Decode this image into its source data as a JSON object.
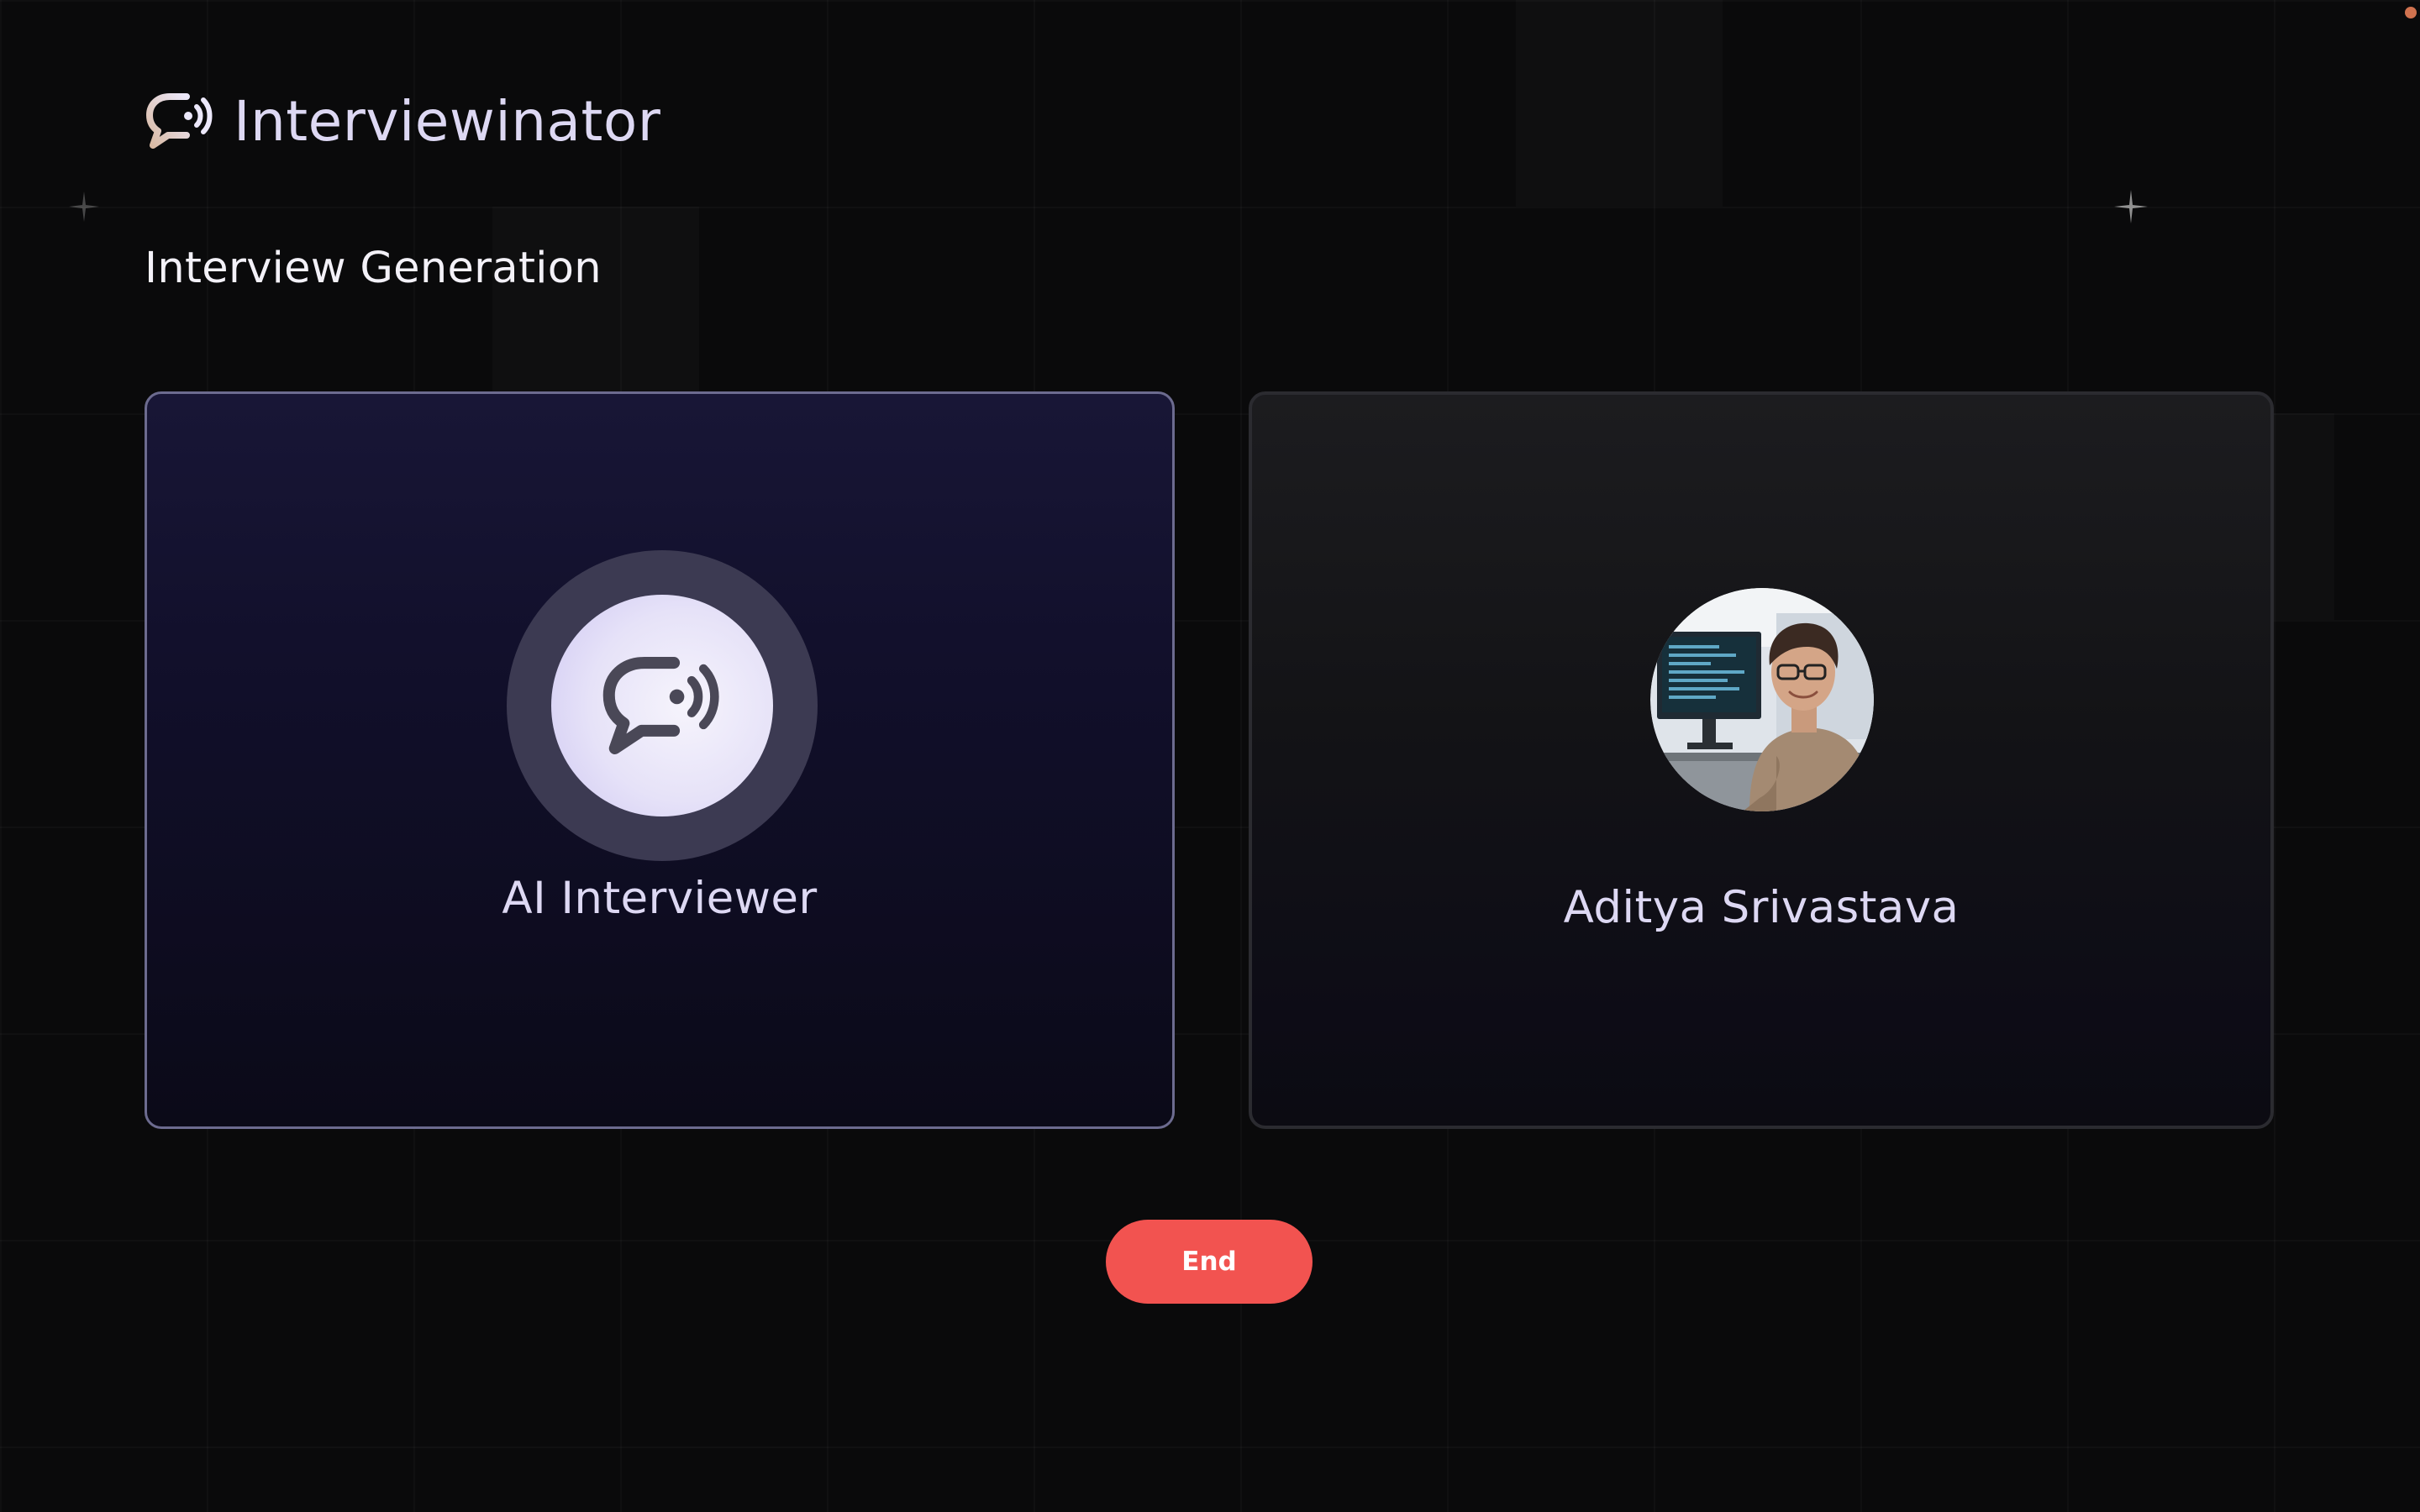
{
  "brand": {
    "name": "Interviewinator",
    "logo_icon": "chat-bubble-broadcast-icon"
  },
  "page": {
    "title": "Interview Generation"
  },
  "cards": {
    "ai": {
      "name": "AI Interviewer",
      "icon": "chat-bubble-broadcast-icon",
      "active": true
    },
    "user": {
      "name": "Aditya Srivastava",
      "avatar": "user-photo-avatar"
    }
  },
  "controls": {
    "end_label": "End"
  },
  "colors": {
    "background": "#0a0a0b",
    "accent_text": "#ddd8f3",
    "end_button": "#f25350",
    "ai_card_border": "#6c6b8f"
  }
}
